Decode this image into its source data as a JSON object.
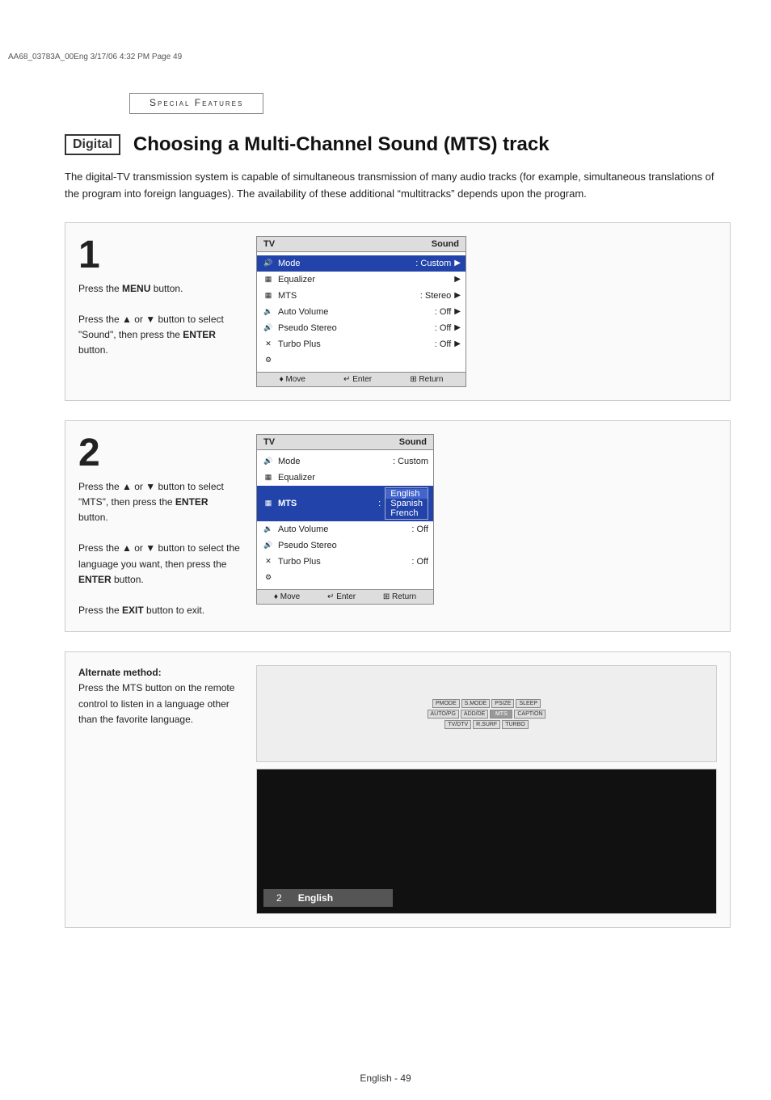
{
  "header": {
    "file_info": "AA68_03783A_00Eng   3/17/06   4:32 PM   Page 49"
  },
  "section_title": "Special Features",
  "digital_badge": "Digital",
  "page_title": "Choosing a Multi-Channel Sound (MTS) track",
  "intro_text": "The digital-TV transmission system is capable of simultaneous transmission of many audio tracks (for example, simultaneous translations of the program into foreign languages). The availability of these additional “multitracks” depends upon the program.",
  "step1": {
    "number": "1",
    "instructions": [
      "Press the MENU button.",
      "Press the ▲ or ▼ button to select “Sound”, then press the ENTER button."
    ],
    "menu": {
      "header_left": "TV",
      "header_right": "Sound",
      "rows": [
        {
          "icon": "♪",
          "label": "Mode",
          "colon": ":",
          "value": "Custom",
          "arrow": "▶",
          "highlighted": true
        },
        {
          "icon": "▦",
          "label": "Equalizer",
          "colon": "",
          "value": "",
          "arrow": "▶",
          "highlighted": false
        },
        {
          "icon": "▦",
          "label": "MTS",
          "colon": ":",
          "value": "Stereo",
          "arrow": "▶",
          "highlighted": false
        },
        {
          "icon": "♪",
          "label": "Auto Volume",
          "colon": ":",
          "value": "Off",
          "arrow": "▶",
          "highlighted": false
        },
        {
          "icon": "♪",
          "label": "Pseudo Stereo",
          "colon": ":",
          "value": "Off",
          "arrow": "▶",
          "highlighted": false
        },
        {
          "icon": "✕",
          "label": "Turbo Plus",
          "colon": ":",
          "value": "Off",
          "arrow": "▶",
          "highlighted": false
        },
        {
          "icon": "⚙",
          "label": "",
          "colon": "",
          "value": "",
          "arrow": "",
          "highlighted": false
        }
      ],
      "footer": [
        "♦ Move",
        "↵ Enter",
        "⊞ Return"
      ]
    }
  },
  "step2": {
    "number": "2",
    "instructions": [
      "Press the ▲ or ▼ button to select “MTS”, then press the ENTER button.",
      "Press the ▲ or ▼ button to select the language you want, then press the ENTER button.",
      "Press the EXIT button to exit."
    ],
    "menu": {
      "header_left": "TV",
      "header_right": "Sound",
      "rows": [
        {
          "icon": "♪",
          "label": "Mode",
          "colon": ":",
          "value": "Custom",
          "arrow": "",
          "highlighted": false
        },
        {
          "icon": "▦",
          "label": "Equalizer",
          "colon": "",
          "value": "",
          "arrow": "",
          "highlighted": false
        },
        {
          "icon": "▦",
          "label": "MTS",
          "colon": ":",
          "value": "",
          "arrow": "",
          "highlighted": true
        },
        {
          "icon": "♪",
          "label": "Auto Volume",
          "colon": ":",
          "value": "Off",
          "arrow": "",
          "highlighted": false
        },
        {
          "icon": "♪",
          "label": "Pseudo Stereo",
          "colon": "",
          "value": "",
          "arrow": "",
          "highlighted": false
        },
        {
          "icon": "✕",
          "label": "Turbo Plus",
          "colon": ":",
          "value": "Off",
          "arrow": "",
          "highlighted": false
        },
        {
          "icon": "⚙",
          "label": "",
          "colon": "",
          "value": "",
          "arrow": "",
          "highlighted": false
        }
      ],
      "dropdown": {
        "options": [
          "English",
          "Spanish",
          "French"
        ],
        "selected": "English"
      },
      "footer": [
        "♦ Move",
        "↵ Enter",
        "⊞ Return"
      ]
    }
  },
  "alternate": {
    "title": "Alternate method:",
    "instructions": "Press the MTS button on the remote control to listen in a language other than the favorite language.",
    "remote": {
      "rows": [
        [
          "PMODE",
          "S.MODE",
          "PSIZE",
          "SLEEP"
        ],
        [
          "AUTO/PG",
          "ADD/DE",
          "MTS",
          "CAPTION"
        ],
        [
          "TV/DTV",
          "R.SURF",
          "TURBO"
        ]
      ]
    },
    "tv_display": {
      "channel": "2",
      "language": "English"
    }
  },
  "footer": {
    "text": "English - 49"
  }
}
